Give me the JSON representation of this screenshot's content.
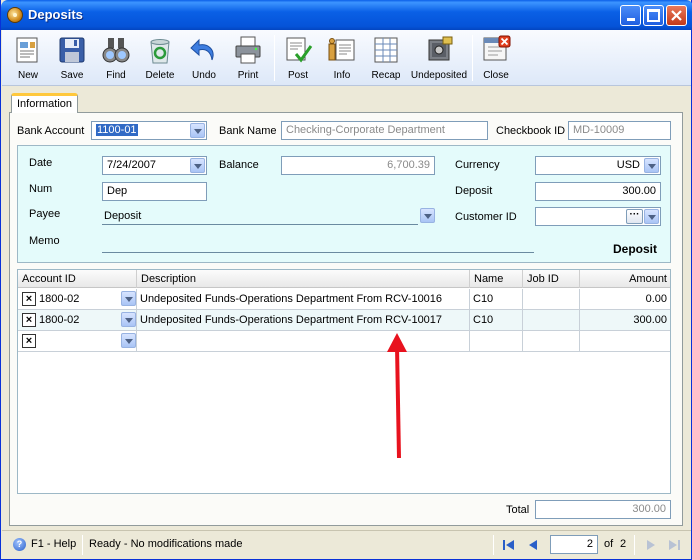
{
  "window": {
    "title": "Deposits",
    "minimize_icon": "minimize-icon",
    "maximize_icon": "maximize-icon",
    "close_icon": "close-icon"
  },
  "toolbar": {
    "items": [
      {
        "label": "New",
        "icon": "new-document-icon"
      },
      {
        "label": "Save",
        "icon": "floppy-disk-icon"
      },
      {
        "label": "Find",
        "icon": "binoculars-icon"
      },
      {
        "label": "Delete",
        "icon": "recycle-bin-icon"
      },
      {
        "label": "Undo",
        "icon": "undo-arrow-icon"
      },
      {
        "label": "Print",
        "icon": "printer-icon"
      },
      {
        "label": "Post",
        "icon": "post-check-icon"
      },
      {
        "label": "Info",
        "icon": "info-icon"
      },
      {
        "label": "Recap",
        "icon": "recap-sheet-icon"
      },
      {
        "label": "Undeposited",
        "icon": "safe-icon"
      },
      {
        "label": "Close",
        "icon": "close-window-icon"
      }
    ]
  },
  "tabs": [
    {
      "label": "Information"
    }
  ],
  "header": {
    "bank_account_label": "Bank Account",
    "bank_account_value": "1100-01",
    "bank_name_label": "Bank Name",
    "bank_name_value": "Checking-Corporate Department",
    "checkbook_id_label": "Checkbook ID",
    "checkbook_id_value": "MD-10009"
  },
  "details": {
    "date_label": "Date",
    "date_value": "7/24/2007",
    "balance_label": "Balance",
    "balance_value": "6,700.39",
    "currency_label": "Currency",
    "currency_value": "USD",
    "num_label": "Num",
    "num_value": "Dep",
    "deposit_label": "Deposit",
    "deposit_value": "300.00",
    "payee_label": "Payee",
    "payee_value": "Deposit",
    "customer_id_label": "Customer ID",
    "customer_id_value": "",
    "ellipsis": "···",
    "memo_label": "Memo",
    "memo_value": "",
    "type_caption": "Deposit"
  },
  "grid": {
    "columns": [
      "Account ID",
      "Description",
      "Name",
      "Job ID",
      "Amount"
    ],
    "rows": [
      {
        "delete": "×",
        "account_id": "1800-02",
        "description": "Undeposited Funds-Operations Department From RCV-10016",
        "name": "C10",
        "job_id": "",
        "amount": "0.00"
      },
      {
        "delete": "×",
        "account_id": "1800-02",
        "description": "Undeposited Funds-Operations Department From RCV-10017",
        "name": "C10",
        "job_id": "",
        "amount": "300.00"
      },
      {
        "delete": "×",
        "account_id": "",
        "description": "",
        "name": "",
        "job_id": "",
        "amount": ""
      }
    ]
  },
  "footer": {
    "total_label": "Total",
    "total_value": "300.00"
  },
  "status": {
    "help_text": "F1 - Help",
    "help_glyph": "?",
    "message": "Ready - No modifications made",
    "page_current": "2",
    "page_of": "of",
    "page_total": "2"
  },
  "annotation": {
    "arrow_color": "#e8121e"
  }
}
